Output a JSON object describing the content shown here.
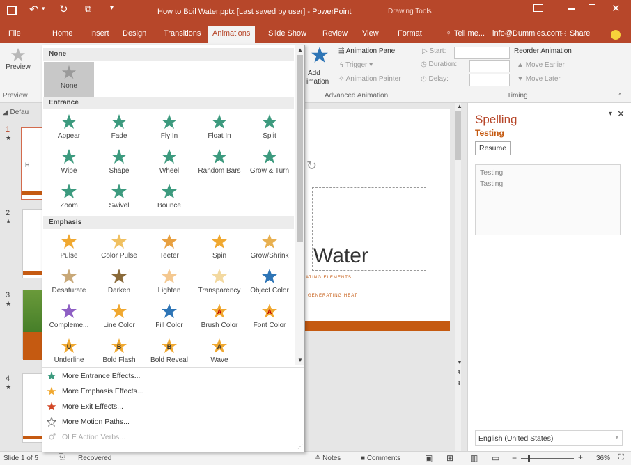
{
  "title": "How to Boil Water.pptx [Last saved by user] - PowerPoint",
  "drawing_tools": "Drawing Tools",
  "tabs": [
    "File",
    "Home",
    "Insert",
    "Design",
    "Transitions",
    "Animations",
    "Slide Show",
    "Review",
    "View",
    "Format"
  ],
  "tell_me": "Tell me...",
  "account": "info@Dummies.com",
  "share": "Share",
  "ribbon": {
    "preview": "Preview",
    "preview_group": "Preview",
    "add_animation": "Add",
    "add_animation2": "imation",
    "animation_pane": "Animation Pane",
    "trigger": "Trigger",
    "animation_painter": "Animation Painter",
    "advanced_group": "Advanced Animation",
    "start": "Start:",
    "duration": "Duration:",
    "delay": "Delay:",
    "reorder": "Reorder Animation",
    "move_earlier": "Move Earlier",
    "move_later": "Move Later",
    "timing_group": "Timing"
  },
  "gallery": {
    "none_header": "None",
    "none_label": "None",
    "entrance_header": "Entrance",
    "entrance": [
      "Appear",
      "Fade",
      "Fly In",
      "Float In",
      "Split",
      "Wipe",
      "Shape",
      "Wheel",
      "Random Bars",
      "Grow & Turn",
      "Zoom",
      "Swivel",
      "Bounce"
    ],
    "emphasis_header": "Emphasis",
    "emphasis": [
      "Pulse",
      "Color Pulse",
      "Teeter",
      "Spin",
      "Grow/Shrink",
      "Desaturate",
      "Darken",
      "Lighten",
      "Transparency",
      "Object Color",
      "Compleme...",
      "Line Color",
      "Fill Color",
      "Brush Color",
      "Font Color",
      "Underline",
      "Bold Flash",
      "Bold Reveal",
      "Wave"
    ],
    "emphasis_letters": [
      "U",
      "B",
      "B",
      "A"
    ],
    "font_letters": [
      "A",
      "A"
    ],
    "more": [
      "More Entrance Effects...",
      "More Emphasis Effects...",
      "More Exit Effects...",
      "More Motion Paths...",
      "OLE Action Verbs..."
    ]
  },
  "thumbs": {
    "section": "Defau",
    "numbers": [
      "1",
      "2",
      "3",
      "4"
    ]
  },
  "slide": {
    "title": "Water",
    "sub1": "EATING ELEMENTS",
    "sub2": "D GENERATING HEAT"
  },
  "spelling": {
    "title": "Spelling",
    "word": "Testing",
    "resume": "Resume",
    "suggestions": [
      "Testing",
      "Tasting"
    ],
    "language": "English (United States)"
  },
  "status": {
    "slide": "Slide 1 of 5",
    "recovered": "Recovered",
    "notes": "Notes",
    "comments": "Comments",
    "zoom": "36%"
  },
  "colors": {
    "accent": "#b7472a",
    "entrance": "#3c9a7e",
    "emphasis": "#f0a830",
    "exit": "#d24726"
  }
}
